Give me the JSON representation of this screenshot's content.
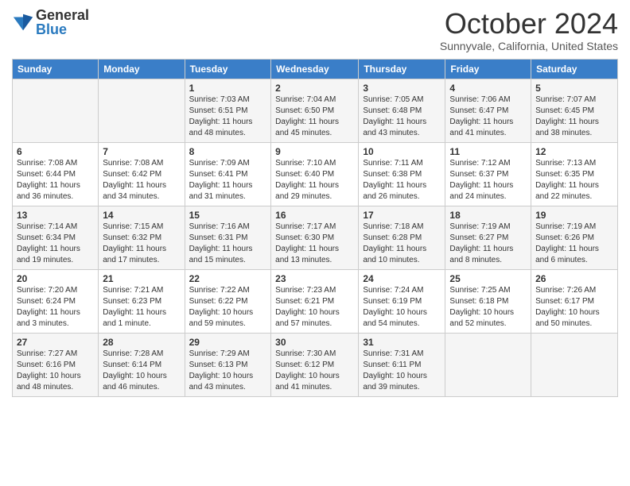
{
  "logo": {
    "general": "General",
    "blue": "Blue"
  },
  "header": {
    "month": "October 2024",
    "location": "Sunnyvale, California, United States"
  },
  "days_of_week": [
    "Sunday",
    "Monday",
    "Tuesday",
    "Wednesday",
    "Thursday",
    "Friday",
    "Saturday"
  ],
  "weeks": [
    [
      {
        "num": "",
        "sunrise": "",
        "sunset": "",
        "daylight": ""
      },
      {
        "num": "",
        "sunrise": "",
        "sunset": "",
        "daylight": ""
      },
      {
        "num": "1",
        "sunrise": "Sunrise: 7:03 AM",
        "sunset": "Sunset: 6:51 PM",
        "daylight": "Daylight: 11 hours and 48 minutes."
      },
      {
        "num": "2",
        "sunrise": "Sunrise: 7:04 AM",
        "sunset": "Sunset: 6:50 PM",
        "daylight": "Daylight: 11 hours and 45 minutes."
      },
      {
        "num": "3",
        "sunrise": "Sunrise: 7:05 AM",
        "sunset": "Sunset: 6:48 PM",
        "daylight": "Daylight: 11 hours and 43 minutes."
      },
      {
        "num": "4",
        "sunrise": "Sunrise: 7:06 AM",
        "sunset": "Sunset: 6:47 PM",
        "daylight": "Daylight: 11 hours and 41 minutes."
      },
      {
        "num": "5",
        "sunrise": "Sunrise: 7:07 AM",
        "sunset": "Sunset: 6:45 PM",
        "daylight": "Daylight: 11 hours and 38 minutes."
      }
    ],
    [
      {
        "num": "6",
        "sunrise": "Sunrise: 7:08 AM",
        "sunset": "Sunset: 6:44 PM",
        "daylight": "Daylight: 11 hours and 36 minutes."
      },
      {
        "num": "7",
        "sunrise": "Sunrise: 7:08 AM",
        "sunset": "Sunset: 6:42 PM",
        "daylight": "Daylight: 11 hours and 34 minutes."
      },
      {
        "num": "8",
        "sunrise": "Sunrise: 7:09 AM",
        "sunset": "Sunset: 6:41 PM",
        "daylight": "Daylight: 11 hours and 31 minutes."
      },
      {
        "num": "9",
        "sunrise": "Sunrise: 7:10 AM",
        "sunset": "Sunset: 6:40 PM",
        "daylight": "Daylight: 11 hours and 29 minutes."
      },
      {
        "num": "10",
        "sunrise": "Sunrise: 7:11 AM",
        "sunset": "Sunset: 6:38 PM",
        "daylight": "Daylight: 11 hours and 26 minutes."
      },
      {
        "num": "11",
        "sunrise": "Sunrise: 7:12 AM",
        "sunset": "Sunset: 6:37 PM",
        "daylight": "Daylight: 11 hours and 24 minutes."
      },
      {
        "num": "12",
        "sunrise": "Sunrise: 7:13 AM",
        "sunset": "Sunset: 6:35 PM",
        "daylight": "Daylight: 11 hours and 22 minutes."
      }
    ],
    [
      {
        "num": "13",
        "sunrise": "Sunrise: 7:14 AM",
        "sunset": "Sunset: 6:34 PM",
        "daylight": "Daylight: 11 hours and 19 minutes."
      },
      {
        "num": "14",
        "sunrise": "Sunrise: 7:15 AM",
        "sunset": "Sunset: 6:32 PM",
        "daylight": "Daylight: 11 hours and 17 minutes."
      },
      {
        "num": "15",
        "sunrise": "Sunrise: 7:16 AM",
        "sunset": "Sunset: 6:31 PM",
        "daylight": "Daylight: 11 hours and 15 minutes."
      },
      {
        "num": "16",
        "sunrise": "Sunrise: 7:17 AM",
        "sunset": "Sunset: 6:30 PM",
        "daylight": "Daylight: 11 hours and 13 minutes."
      },
      {
        "num": "17",
        "sunrise": "Sunrise: 7:18 AM",
        "sunset": "Sunset: 6:28 PM",
        "daylight": "Daylight: 11 hours and 10 minutes."
      },
      {
        "num": "18",
        "sunrise": "Sunrise: 7:19 AM",
        "sunset": "Sunset: 6:27 PM",
        "daylight": "Daylight: 11 hours and 8 minutes."
      },
      {
        "num": "19",
        "sunrise": "Sunrise: 7:19 AM",
        "sunset": "Sunset: 6:26 PM",
        "daylight": "Daylight: 11 hours and 6 minutes."
      }
    ],
    [
      {
        "num": "20",
        "sunrise": "Sunrise: 7:20 AM",
        "sunset": "Sunset: 6:24 PM",
        "daylight": "Daylight: 11 hours and 3 minutes."
      },
      {
        "num": "21",
        "sunrise": "Sunrise: 7:21 AM",
        "sunset": "Sunset: 6:23 PM",
        "daylight": "Daylight: 11 hours and 1 minute."
      },
      {
        "num": "22",
        "sunrise": "Sunrise: 7:22 AM",
        "sunset": "Sunset: 6:22 PM",
        "daylight": "Daylight: 10 hours and 59 minutes."
      },
      {
        "num": "23",
        "sunrise": "Sunrise: 7:23 AM",
        "sunset": "Sunset: 6:21 PM",
        "daylight": "Daylight: 10 hours and 57 minutes."
      },
      {
        "num": "24",
        "sunrise": "Sunrise: 7:24 AM",
        "sunset": "Sunset: 6:19 PM",
        "daylight": "Daylight: 10 hours and 54 minutes."
      },
      {
        "num": "25",
        "sunrise": "Sunrise: 7:25 AM",
        "sunset": "Sunset: 6:18 PM",
        "daylight": "Daylight: 10 hours and 52 minutes."
      },
      {
        "num": "26",
        "sunrise": "Sunrise: 7:26 AM",
        "sunset": "Sunset: 6:17 PM",
        "daylight": "Daylight: 10 hours and 50 minutes."
      }
    ],
    [
      {
        "num": "27",
        "sunrise": "Sunrise: 7:27 AM",
        "sunset": "Sunset: 6:16 PM",
        "daylight": "Daylight: 10 hours and 48 minutes."
      },
      {
        "num": "28",
        "sunrise": "Sunrise: 7:28 AM",
        "sunset": "Sunset: 6:14 PM",
        "daylight": "Daylight: 10 hours and 46 minutes."
      },
      {
        "num": "29",
        "sunrise": "Sunrise: 7:29 AM",
        "sunset": "Sunset: 6:13 PM",
        "daylight": "Daylight: 10 hours and 43 minutes."
      },
      {
        "num": "30",
        "sunrise": "Sunrise: 7:30 AM",
        "sunset": "Sunset: 6:12 PM",
        "daylight": "Daylight: 10 hours and 41 minutes."
      },
      {
        "num": "31",
        "sunrise": "Sunrise: 7:31 AM",
        "sunset": "Sunset: 6:11 PM",
        "daylight": "Daylight: 10 hours and 39 minutes."
      },
      {
        "num": "",
        "sunrise": "",
        "sunset": "",
        "daylight": ""
      },
      {
        "num": "",
        "sunrise": "",
        "sunset": "",
        "daylight": ""
      }
    ]
  ]
}
